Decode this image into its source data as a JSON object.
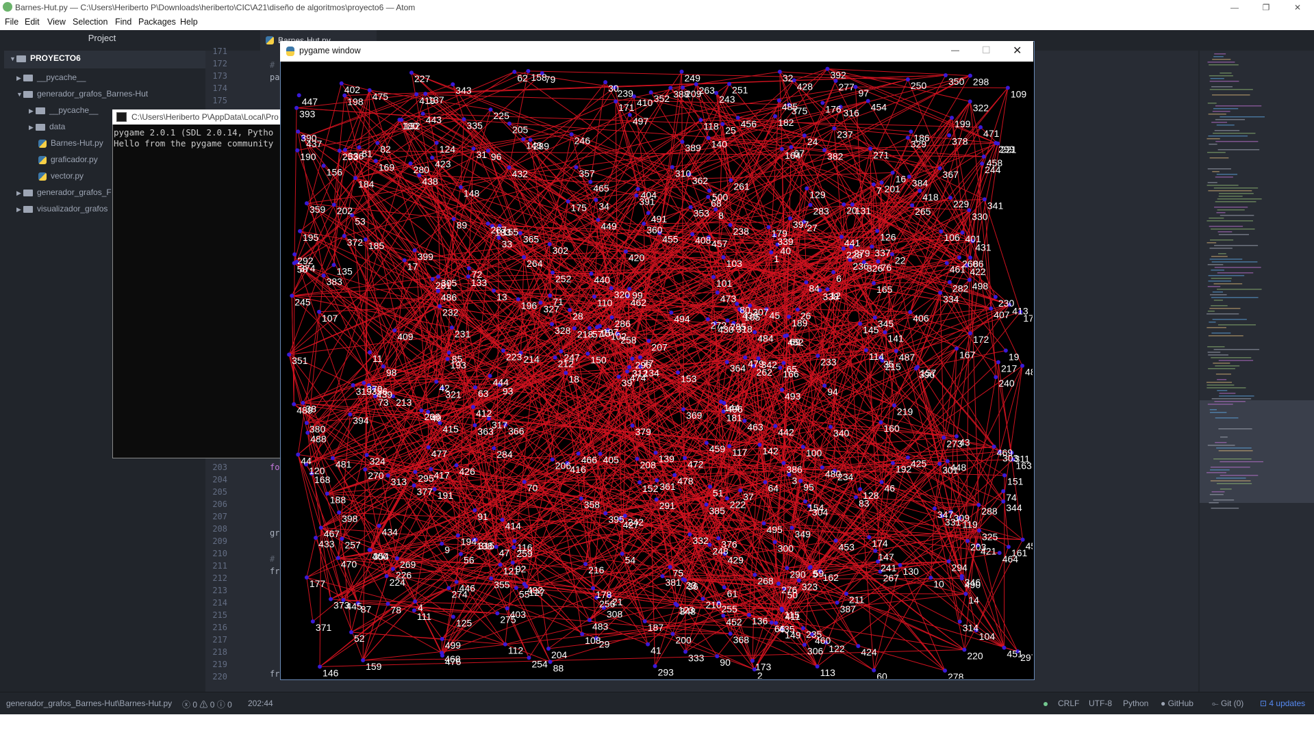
{
  "window": {
    "title": "Barnes-Hut.py — C:\\Users\\Heriberto P\\Downloads\\heriberto\\CIC\\A21\\diseño de algoritmos\\proyecto6 — Atom",
    "minimize": "—",
    "restore": "❐",
    "close": "✕"
  },
  "menu": [
    "File",
    "Edit",
    "View",
    "Selection",
    "Find",
    "Packages",
    "Help"
  ],
  "tree": {
    "header": "Project",
    "items": [
      {
        "label": "PROYECTO6",
        "type": "root",
        "depth": 0
      },
      {
        "label": "__pycache__",
        "type": "folder",
        "depth": 1
      },
      {
        "label": "generador_grafos_Barnes-Hut",
        "type": "folder-open",
        "depth": 1
      },
      {
        "label": "__pycache__",
        "type": "folder",
        "depth": 2
      },
      {
        "label": "data",
        "type": "folder",
        "depth": 2
      },
      {
        "label": "Barnes-Hut.py",
        "type": "py",
        "depth": 2
      },
      {
        "label": "graficador.py",
        "type": "py",
        "depth": 2
      },
      {
        "label": "vector.py",
        "type": "py",
        "depth": 2
      },
      {
        "label": "generador_grafos_F",
        "type": "folder",
        "depth": 1
      },
      {
        "label": "visualizador_grafos",
        "type": "folder",
        "depth": 1
      }
    ]
  },
  "editor": {
    "tab_label": "Barnes-Hut.py",
    "line_numbers": [
      "171",
      "172",
      "173",
      "174",
      "175",
      "203",
      "204",
      "205",
      "206",
      "207",
      "208",
      "209",
      "210",
      "211",
      "212",
      "213",
      "214",
      "215",
      "216",
      "217",
      "218",
      "219",
      "220"
    ],
    "code_fragments": [
      "#",
      "pa",
      "fo",
      "gr",
      "#",
      "fr",
      "fr"
    ]
  },
  "console": {
    "title": "C:\\Users\\Heriberto P\\AppData\\Local\\Pro",
    "lines": [
      "pygame 2.0.1 (SDL 2.0.14, Pytho",
      "Hello from the pygame community"
    ]
  },
  "pygame": {
    "title": "pygame window",
    "minimize": "—",
    "maximize": "☐",
    "close": "✕",
    "edge_color": "#d0121f",
    "node_color": "#3a1ad8",
    "label_color": "#ffffff"
  },
  "status": {
    "path": "generador_grafos_Barnes-Hut\\Barnes-Hut.py",
    "errors": "0",
    "warnings": "0",
    "infos": "0",
    "cursor": "202:44",
    "line_ending": "CRLF",
    "encoding": "UTF-8",
    "grammar": "Python",
    "github": "GitHub",
    "git": "Git (0)",
    "updates": "4 updates"
  }
}
